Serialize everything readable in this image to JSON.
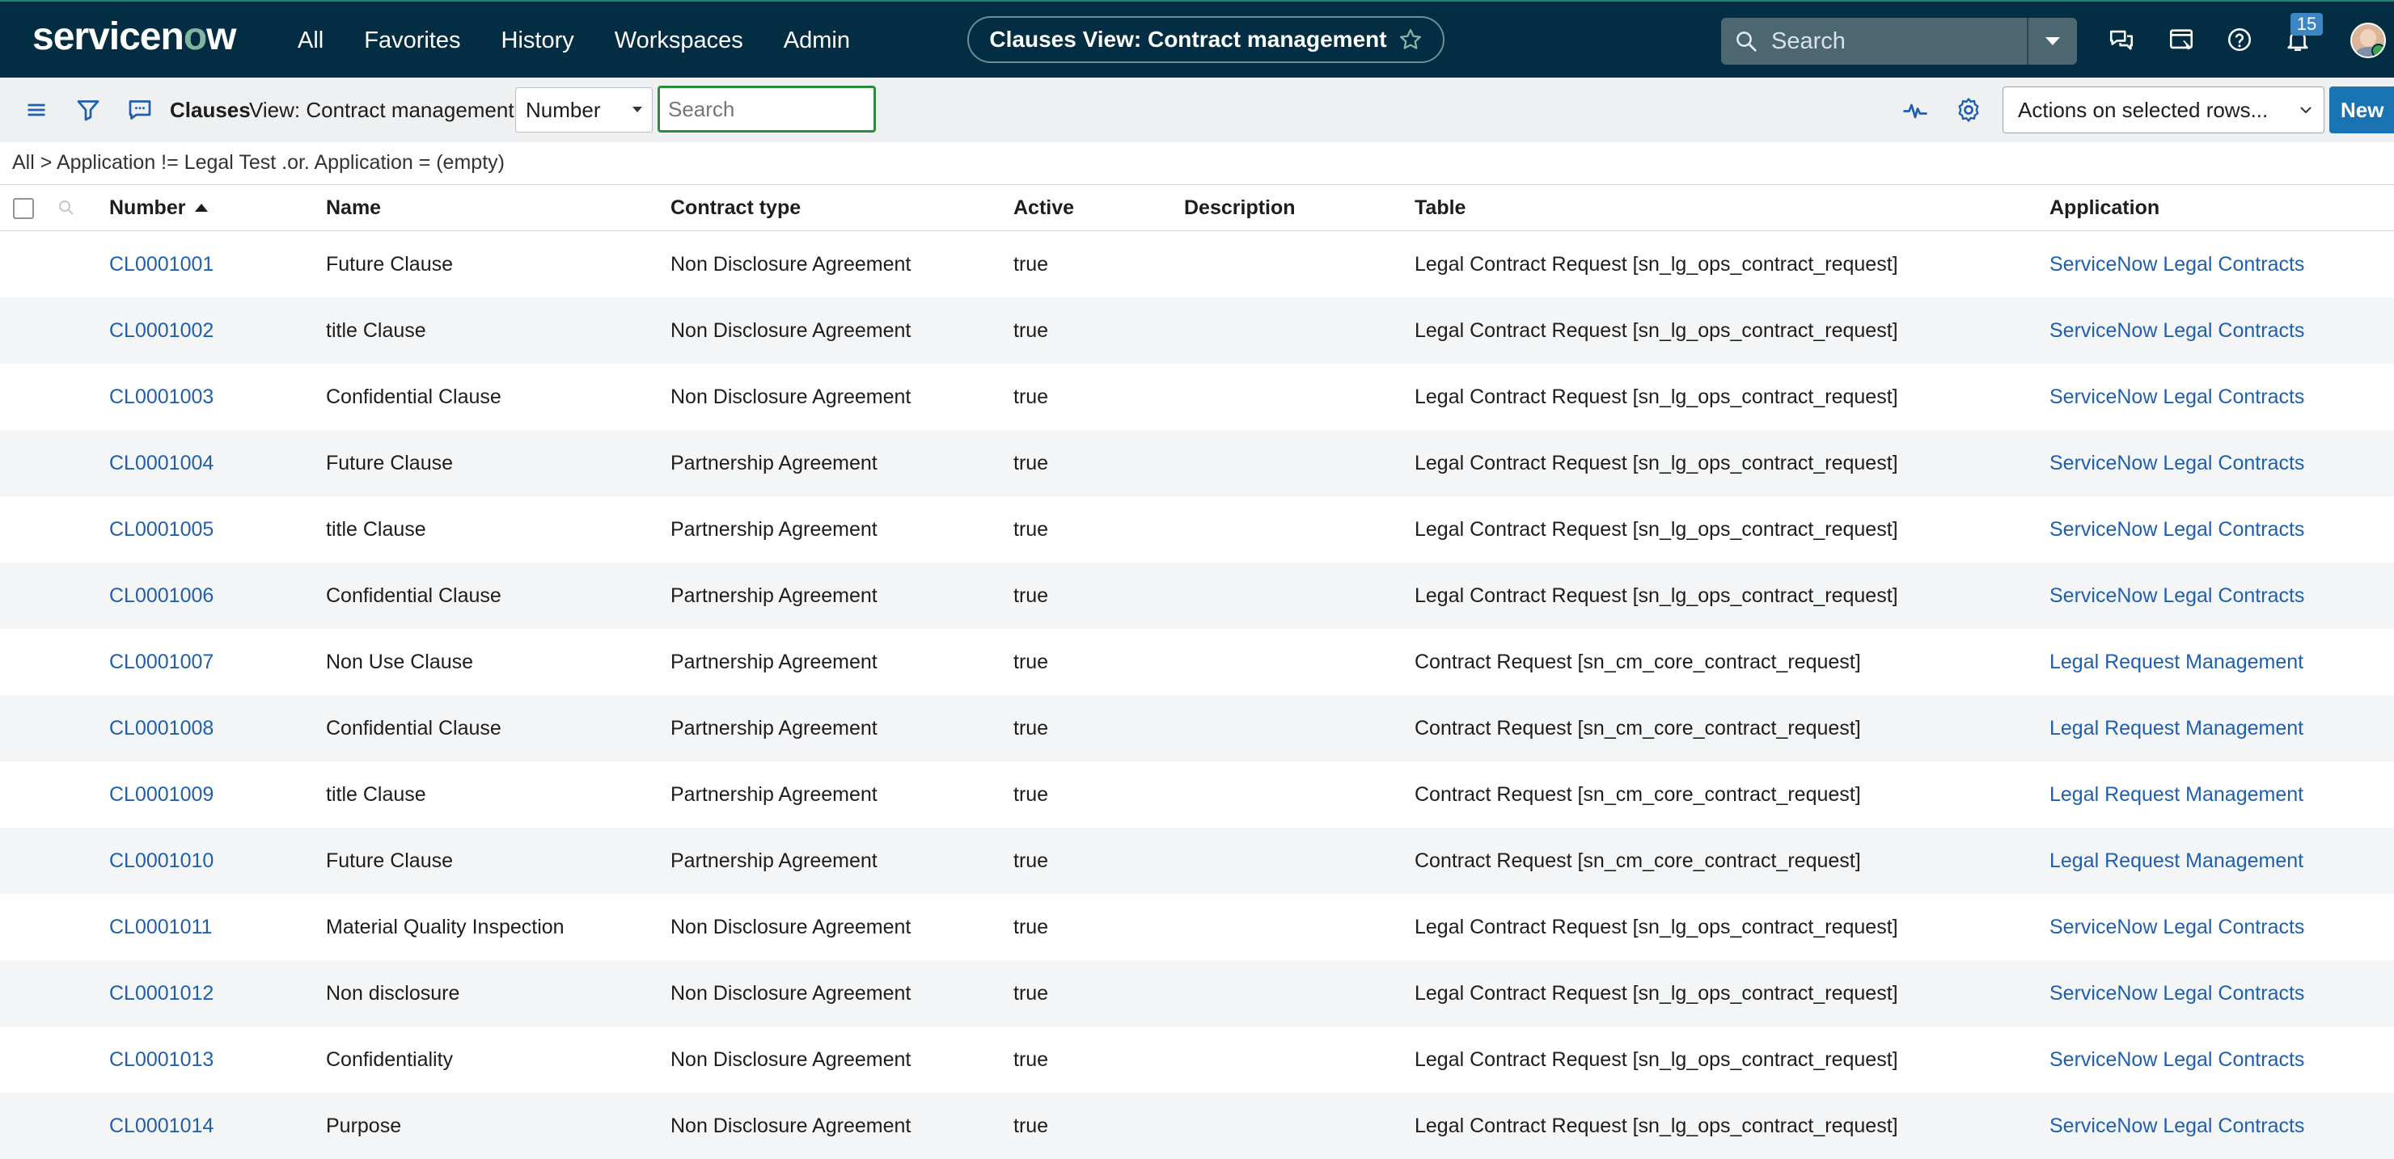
{
  "brand": {
    "name_part1": "servicen",
    "name_o": "o",
    "name_part2": "w"
  },
  "nav": {
    "items": [
      "All",
      "Favorites",
      "History",
      "Workspaces",
      "Admin"
    ]
  },
  "context": {
    "title": "Clauses View: Contract management"
  },
  "global_search": {
    "placeholder": "Search"
  },
  "notifications": {
    "count": "15"
  },
  "toolbar": {
    "title": "Clauses",
    "view": "View: Contract management",
    "field_select": "Number",
    "search_placeholder": "Search",
    "actions_select": "Actions on selected rows...",
    "new_label": "New"
  },
  "breadcrumb": {
    "all": "All",
    "separator": ">",
    "filter": "Application != Legal Test .or. Application = (empty)"
  },
  "table": {
    "columns": [
      "Number",
      "Name",
      "Contract type",
      "Active",
      "Description",
      "Table",
      "Application"
    ],
    "rows": [
      {
        "number": "CL0001001",
        "name": "Future Clause",
        "contract_type": "Non Disclosure Agreement",
        "active": "true",
        "description": "",
        "table": "Legal Contract Request [sn_lg_ops_contract_request]",
        "application": "ServiceNow Legal Contracts"
      },
      {
        "number": "CL0001002",
        "name": "title Clause",
        "contract_type": "Non Disclosure Agreement",
        "active": "true",
        "description": "",
        "table": "Legal Contract Request [sn_lg_ops_contract_request]",
        "application": "ServiceNow Legal Contracts"
      },
      {
        "number": "CL0001003",
        "name": "Confidential Clause",
        "contract_type": "Non Disclosure Agreement",
        "active": "true",
        "description": "",
        "table": "Legal Contract Request [sn_lg_ops_contract_request]",
        "application": "ServiceNow Legal Contracts"
      },
      {
        "number": "CL0001004",
        "name": "Future Clause",
        "contract_type": "Partnership Agreement",
        "active": "true",
        "description": "",
        "table": "Legal Contract Request [sn_lg_ops_contract_request]",
        "application": "ServiceNow Legal Contracts"
      },
      {
        "number": "CL0001005",
        "name": "title Clause",
        "contract_type": "Partnership Agreement",
        "active": "true",
        "description": "",
        "table": "Legal Contract Request [sn_lg_ops_contract_request]",
        "application": "ServiceNow Legal Contracts"
      },
      {
        "number": "CL0001006",
        "name": "Confidential Clause",
        "contract_type": "Partnership Agreement",
        "active": "true",
        "description": "",
        "table": "Legal Contract Request [sn_lg_ops_contract_request]",
        "application": "ServiceNow Legal Contracts"
      },
      {
        "number": "CL0001007",
        "name": "Non Use Clause",
        "contract_type": "Partnership Agreement",
        "active": "true",
        "description": "",
        "table": "Contract Request [sn_cm_core_contract_request]",
        "application": "Legal Request Management"
      },
      {
        "number": "CL0001008",
        "name": "Confidential Clause",
        "contract_type": "Partnership Agreement",
        "active": "true",
        "description": "",
        "table": "Contract Request [sn_cm_core_contract_request]",
        "application": "Legal Request Management"
      },
      {
        "number": "CL0001009",
        "name": "title Clause",
        "contract_type": "Partnership Agreement",
        "active": "true",
        "description": "",
        "table": "Contract Request [sn_cm_core_contract_request]",
        "application": "Legal Request Management"
      },
      {
        "number": "CL0001010",
        "name": "Future Clause",
        "contract_type": "Partnership Agreement",
        "active": "true",
        "description": "",
        "table": "Contract Request [sn_cm_core_contract_request]",
        "application": "Legal Request Management"
      },
      {
        "number": "CL0001011",
        "name": "Material Quality Inspection",
        "contract_type": "Non Disclosure Agreement",
        "active": "true",
        "description": "",
        "table": "Legal Contract Request [sn_lg_ops_contract_request]",
        "application": "ServiceNow Legal Contracts"
      },
      {
        "number": "CL0001012",
        "name": "Non disclosure",
        "contract_type": "Non Disclosure Agreement",
        "active": "true",
        "description": "",
        "table": "Legal Contract Request [sn_lg_ops_contract_request]",
        "application": "ServiceNow Legal Contracts"
      },
      {
        "number": "CL0001013",
        "name": "Confidentiality",
        "contract_type": "Non Disclosure Agreement",
        "active": "true",
        "description": "",
        "table": "Legal Contract Request [sn_lg_ops_contract_request]",
        "application": "ServiceNow Legal Contracts"
      },
      {
        "number": "CL0001014",
        "name": "Purpose",
        "contract_type": "Non Disclosure Agreement",
        "active": "true",
        "description": "",
        "table": "Legal Contract Request [sn_lg_ops_contract_request]",
        "application": "ServiceNow Legal Contracts"
      }
    ]
  },
  "icons": {
    "hamburger": "hamburger-menu-icon",
    "filter": "filter-icon",
    "chat": "chat-bubble-icon",
    "star": "star-icon",
    "search": "search-icon",
    "connect": "chat-icon",
    "workspace": "workspace-icon",
    "help": "help-icon",
    "bell": "bell-icon",
    "activity": "activity-icon",
    "gear": "gear-icon"
  },
  "colors": {
    "nav_bg": "#032d42",
    "link": "#1f5fae",
    "accent_green": "#81b5a1",
    "new_button": "#1a74b4",
    "search_focus": "#2e8b3c"
  }
}
